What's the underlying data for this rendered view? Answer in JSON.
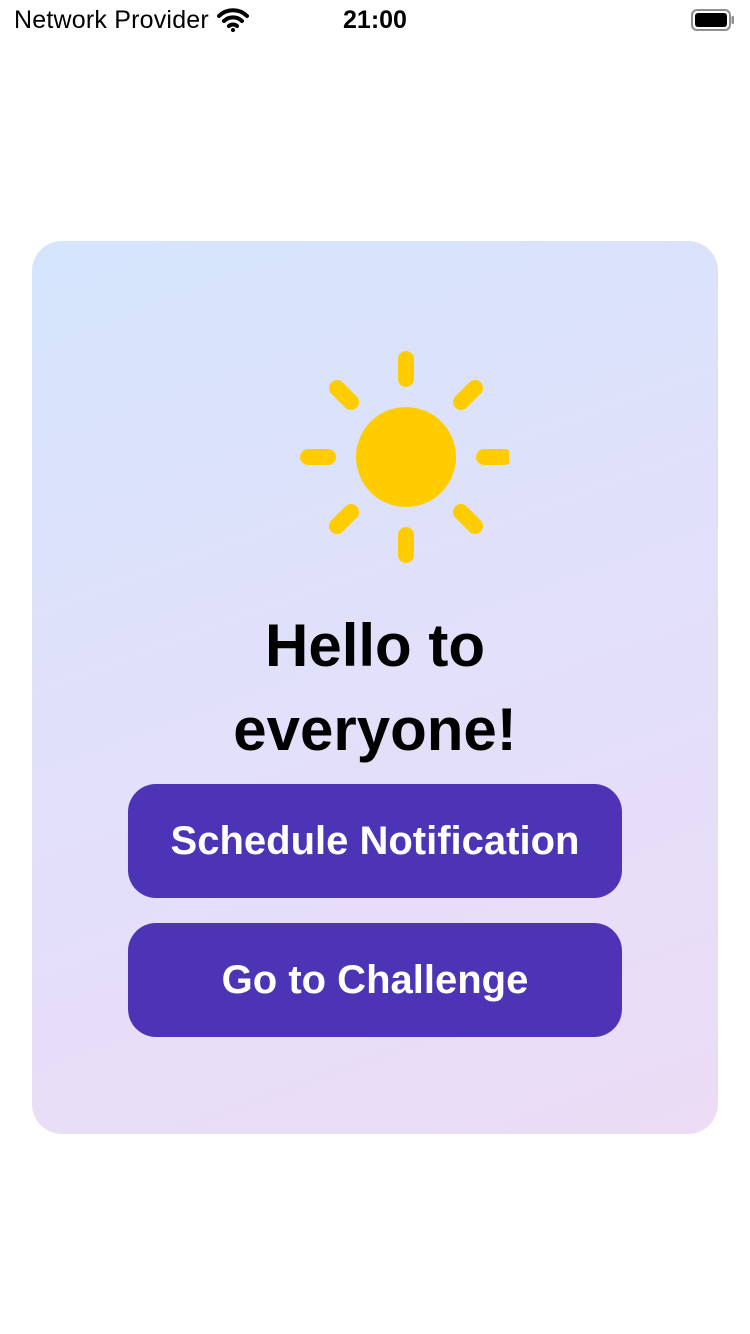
{
  "status_bar": {
    "carrier": "Network Provider",
    "time": "21:00",
    "icons": [
      "wifi-icon",
      "battery-icon"
    ]
  },
  "card": {
    "icon": "sun-icon",
    "icon_color": "#ffcc00",
    "greeting": "Hello to everyone!",
    "gradient_start": "#d4e5fc",
    "gradient_end": "#ecdcf6"
  },
  "actions": {
    "schedule_label": "Schedule Notification",
    "challenge_label": "Go to Challenge",
    "button_color": "#4d33b5"
  }
}
